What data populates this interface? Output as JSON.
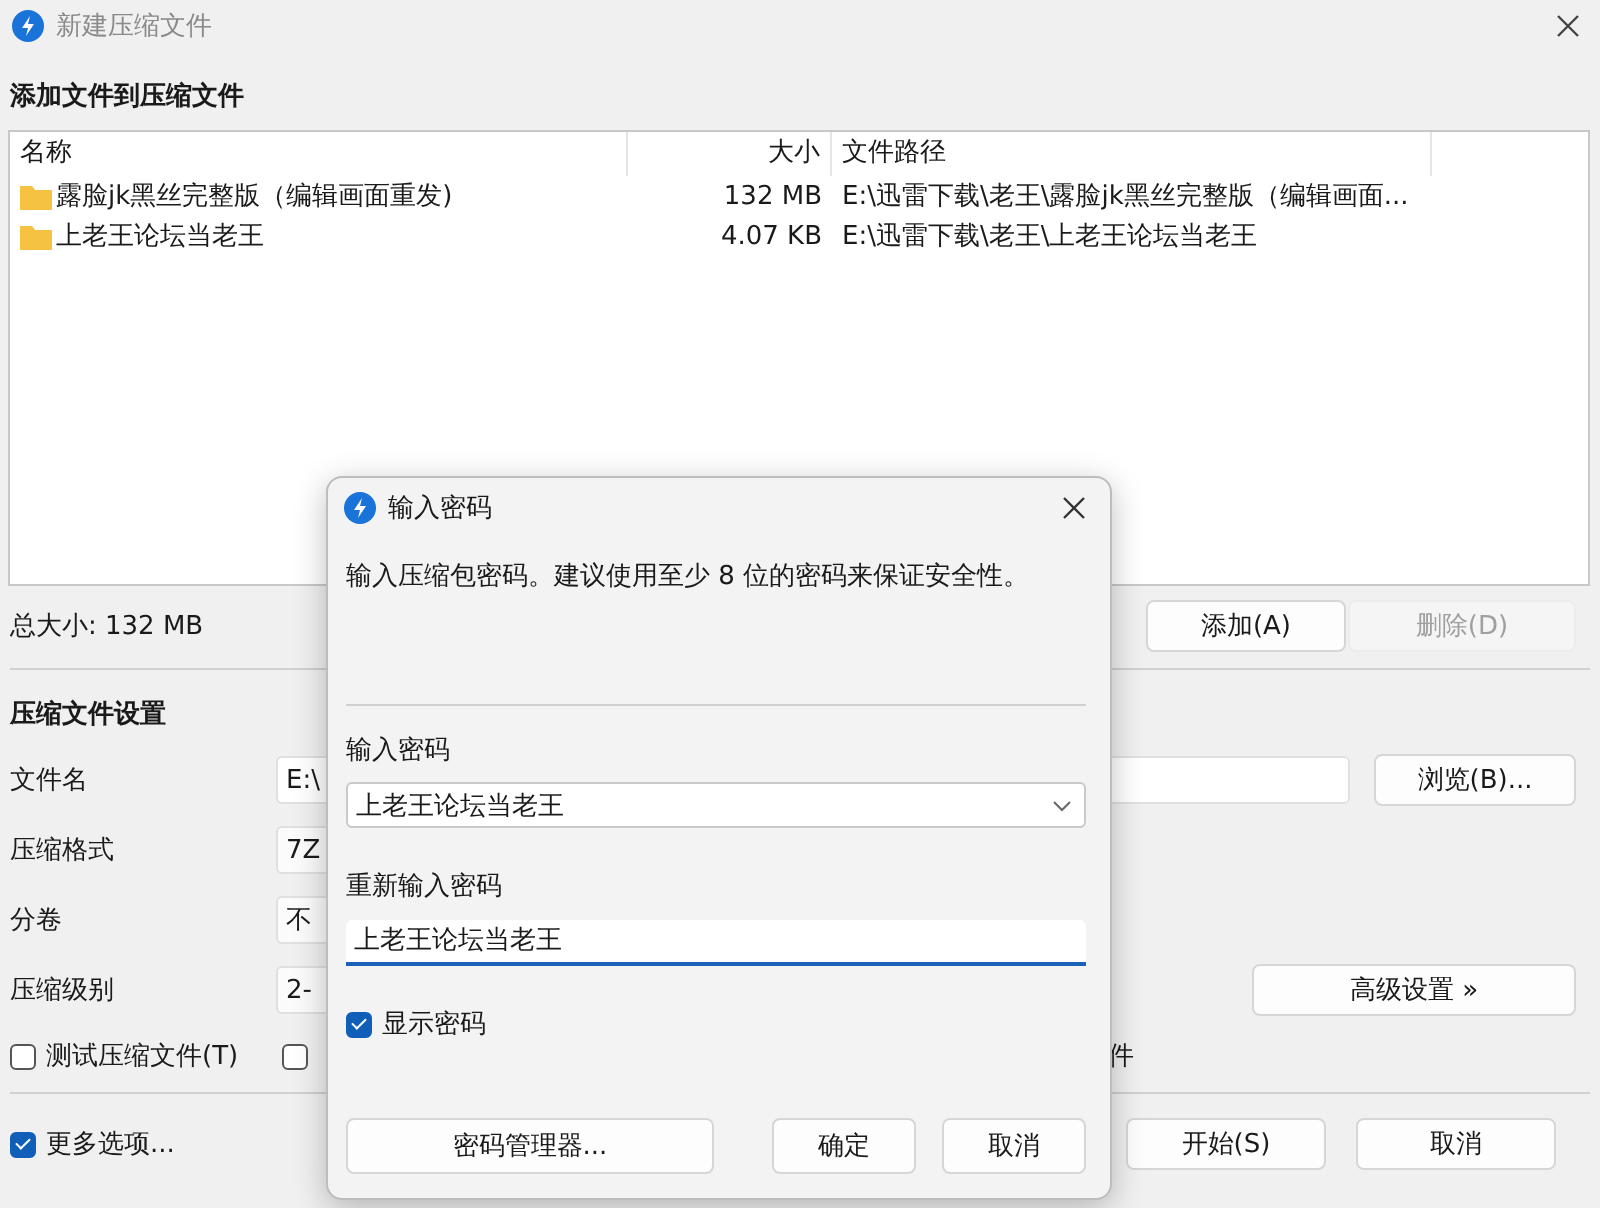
{
  "window": {
    "title": "新建压缩文件"
  },
  "files": {
    "heading": "添加文件到压缩文件",
    "columns": [
      "名称",
      "大小",
      "文件路径"
    ],
    "rows": [
      {
        "name": "露脸jk黑丝完整版（编辑画面重发)",
        "size": "132 MB",
        "path": "E:\\迅雷下载\\老王\\露脸jk黑丝完整版（编辑画面..."
      },
      {
        "name": "上老王论坛当老王",
        "size": "4.07 KB",
        "path": "E:\\迅雷下载\\老王\\上老王论坛当老王"
      }
    ]
  },
  "total_size": "总大小: 132 MB",
  "list_buttons": [
    {
      "label": "添加(A)",
      "disabled": false
    },
    {
      "label": "删除(D)",
      "disabled": true
    }
  ],
  "settings": {
    "heading": "压缩文件设置",
    "fields": [
      {
        "label": "文件名",
        "value": "E:\\",
        "kind": "input"
      },
      {
        "label": "压缩格式",
        "value": "7Z",
        "kind": "dropdown"
      },
      {
        "label": "分卷",
        "value": "不",
        "kind": "dropdown"
      },
      {
        "label": "压缩级别",
        "value": "2-",
        "kind": "dropdown"
      }
    ],
    "browse_button": "浏览(B)...",
    "advanced_button": "高级设置 »",
    "options": [
      {
        "label": "测试压缩文件(T)",
        "checked": false
      },
      {
        "label": "件",
        "checked": false
      }
    ]
  },
  "more_options": {
    "label": "更多选项...",
    "checked": true
  },
  "footer_buttons": [
    "开始(S)",
    "取消"
  ],
  "dialog": {
    "title": "输入密码",
    "message": "输入压缩包密码。建议使用至少 8 位的密码来保证安全性。",
    "password_label": "输入密码",
    "password_value": "上老王论坛当老王",
    "confirm_label": "重新输入密码",
    "confirm_value": "上老王论坛当老王",
    "show_password": {
      "label": "显示密码",
      "checked": true
    },
    "buttons": [
      "密码管理器...",
      "确定",
      "取消"
    ]
  }
}
